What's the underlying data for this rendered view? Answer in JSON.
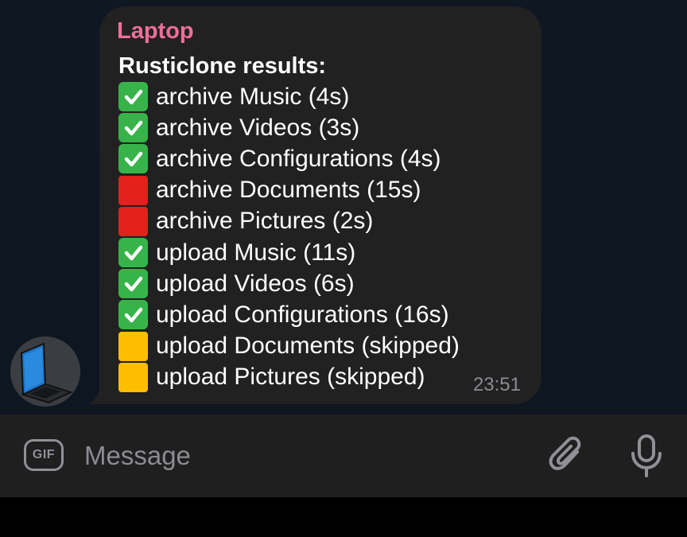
{
  "message": {
    "sender": "Laptop",
    "title": "Rusticlone results:",
    "time": "23:51",
    "lines": [
      {
        "status": "success",
        "text": "archive Music (4s)"
      },
      {
        "status": "success",
        "text": "archive Videos (3s)"
      },
      {
        "status": "success",
        "text": "archive Configurations (4s)"
      },
      {
        "status": "failure",
        "text": "archive Documents (15s)"
      },
      {
        "status": "failure",
        "text": "archive Pictures (2s)"
      },
      {
        "status": "success",
        "text": "upload Music (11s)"
      },
      {
        "status": "success",
        "text": "upload Videos (6s)"
      },
      {
        "status": "success",
        "text": "upload Configurations (16s)"
      },
      {
        "status": "skipped",
        "text": "upload Documents (skipped)"
      },
      {
        "status": "skipped",
        "text": "upload Pictures (skipped)"
      }
    ]
  },
  "composer": {
    "gif_label": "GIF",
    "placeholder": "Message",
    "attach_icon": "paperclip-icon",
    "mic_icon": "microphone-icon"
  },
  "avatar": {
    "icon": "laptop-icon"
  },
  "colors": {
    "sender": "#ee6f9a",
    "bubble": "#212122",
    "success": "#38b34a",
    "failure": "#e3201b",
    "skipped": "#ffbf00"
  }
}
